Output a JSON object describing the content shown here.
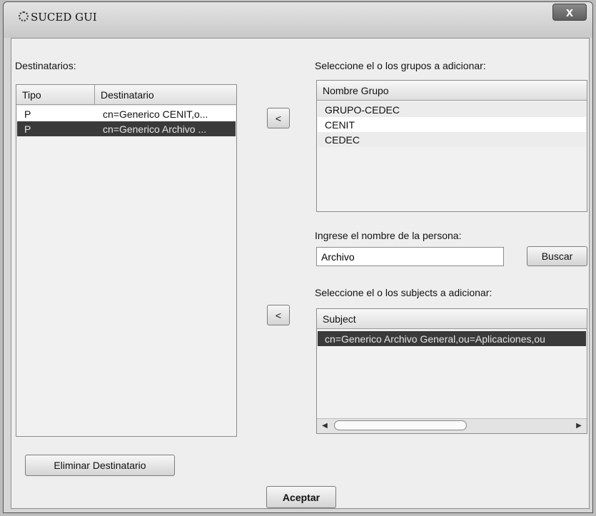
{
  "window": {
    "title": "SUCED GUI",
    "close_label": "x"
  },
  "left": {
    "label": "Destinatarios:",
    "columns": [
      "Tipo",
      "Destinatario"
    ],
    "rows": [
      {
        "tipo": "P",
        "destinatario": "cn=Generico CENIT,o...",
        "selected": false
      },
      {
        "tipo": "P",
        "destinatario": "cn=Generico Archivo ...",
        "selected": true
      }
    ],
    "delete_button": "Eliminar Destinatario"
  },
  "middle": {
    "add_group_button": "<",
    "add_subject_button": "<"
  },
  "groups": {
    "label": "Seleccione el o los grupos a adicionar:",
    "header": "Nombre Grupo",
    "items": [
      "GRUPO-CEDEC",
      "CENIT",
      "CEDEC"
    ]
  },
  "search": {
    "label": "Ingrese el nombre de la persona:",
    "value": "Archivo",
    "button": "Buscar"
  },
  "subjects": {
    "label": "Seleccione el o los subjects a adicionar:",
    "header": "Subject",
    "items": [
      "cn=Generico Archivo General,ou=Aplicaciones,ou"
    ]
  },
  "footer": {
    "accept_button": "Aceptar"
  }
}
